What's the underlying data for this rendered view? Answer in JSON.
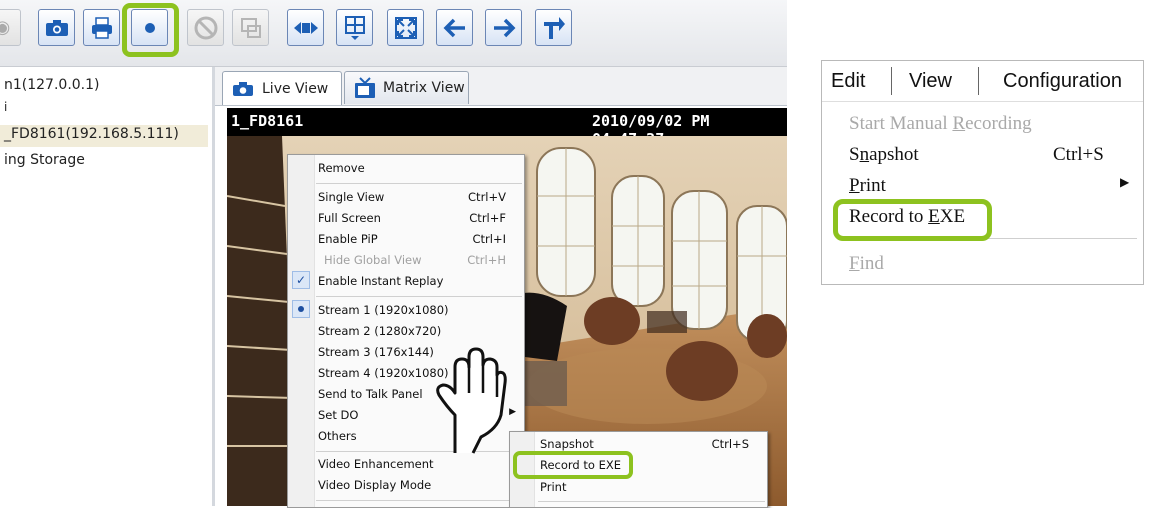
{
  "toolbar": {
    "icons": [
      "prev-icon",
      "camera-icon",
      "print-icon",
      "record-icon",
      "no-entry-icon",
      "layout-icon",
      "fullscreen-icon",
      "matrix-icon",
      "expand-icon",
      "back-arrow-icon",
      "forward-arrow-icon",
      "pin-icon"
    ],
    "highlight_color": "#8dc21f"
  },
  "tree": {
    "items": [
      "n1(127.0.0.1)",
      "i",
      "_FD8161(192.168.5.111)",
      "ing Storage"
    ]
  },
  "tabs": [
    {
      "label": "Live View",
      "icon": "camera-icon"
    },
    {
      "label": "Matrix View",
      "icon": "tv-icon"
    }
  ],
  "video": {
    "camera_name": "1_FD8161",
    "timestamp": "2010/09/02 PM 04:47:27"
  },
  "context_menu": {
    "items": [
      {
        "label": "Remove",
        "shortcut": ""
      },
      {
        "label": "Single View",
        "shortcut": "Ctrl+V"
      },
      {
        "label": "Full Screen",
        "shortcut": "Ctrl+F"
      },
      {
        "label": "Enable PiP",
        "shortcut": "Ctrl+I"
      },
      {
        "label": "Hide Global View",
        "shortcut": "Ctrl+H"
      },
      {
        "label": "Enable Instant Replay",
        "shortcut": ""
      },
      {
        "label": "Stream 1 (1920x1080)",
        "shortcut": ""
      },
      {
        "label": "Stream 2 (1280x720)",
        "shortcut": ""
      },
      {
        "label": "Stream 3 (176x144)",
        "shortcut": ""
      },
      {
        "label": "Stream 4 (1920x1080)",
        "shortcut": ""
      },
      {
        "label": "Send to Talk Panel",
        "shortcut": ""
      },
      {
        "label": "Set DO",
        "shortcut": ""
      },
      {
        "label": "Others",
        "shortcut": ""
      },
      {
        "label": "Video Enhancement",
        "shortcut": ""
      },
      {
        "label": "Video Display Mode",
        "shortcut": ""
      }
    ]
  },
  "submenu": {
    "items": [
      {
        "label": "Snapshot",
        "shortcut": "Ctrl+S"
      },
      {
        "label": "Record to EXE",
        "shortcut": ""
      },
      {
        "label": "Print",
        "shortcut": ""
      }
    ]
  },
  "menubar": {
    "items": [
      "Edit",
      "View",
      "Configuration"
    ]
  },
  "edit_menu": {
    "start_pre": "Start Manual ",
    "start_u": "R",
    "start_post": "ecording",
    "snapshot_pre": "S",
    "snapshot_u": "n",
    "snapshot_post": "apshot",
    "snapshot_shortcut": "Ctrl+S",
    "print_u": "P",
    "print_post": "rint",
    "record_pre": "Record to ",
    "record_u": "E",
    "record_post": "XE",
    "find_u": "F",
    "find_post": "ind"
  }
}
